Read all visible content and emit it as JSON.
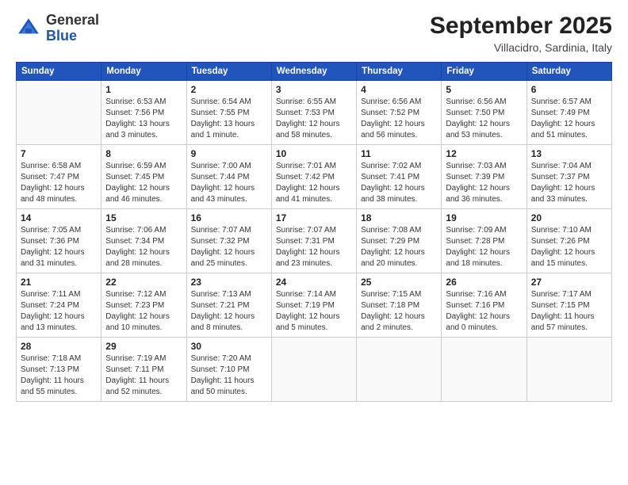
{
  "header": {
    "logo_general": "General",
    "logo_blue": "Blue",
    "month_title": "September 2025",
    "subtitle": "Villacidro, Sardinia, Italy"
  },
  "days_of_week": [
    "Sunday",
    "Monday",
    "Tuesday",
    "Wednesday",
    "Thursday",
    "Friday",
    "Saturday"
  ],
  "weeks": [
    [
      {
        "day": "",
        "info": ""
      },
      {
        "day": "1",
        "info": "Sunrise: 6:53 AM\nSunset: 7:56 PM\nDaylight: 13 hours\nand 3 minutes."
      },
      {
        "day": "2",
        "info": "Sunrise: 6:54 AM\nSunset: 7:55 PM\nDaylight: 13 hours\nand 1 minute."
      },
      {
        "day": "3",
        "info": "Sunrise: 6:55 AM\nSunset: 7:53 PM\nDaylight: 12 hours\nand 58 minutes."
      },
      {
        "day": "4",
        "info": "Sunrise: 6:56 AM\nSunset: 7:52 PM\nDaylight: 12 hours\nand 56 minutes."
      },
      {
        "day": "5",
        "info": "Sunrise: 6:56 AM\nSunset: 7:50 PM\nDaylight: 12 hours\nand 53 minutes."
      },
      {
        "day": "6",
        "info": "Sunrise: 6:57 AM\nSunset: 7:49 PM\nDaylight: 12 hours\nand 51 minutes."
      }
    ],
    [
      {
        "day": "7",
        "info": "Sunrise: 6:58 AM\nSunset: 7:47 PM\nDaylight: 12 hours\nand 48 minutes."
      },
      {
        "day": "8",
        "info": "Sunrise: 6:59 AM\nSunset: 7:45 PM\nDaylight: 12 hours\nand 46 minutes."
      },
      {
        "day": "9",
        "info": "Sunrise: 7:00 AM\nSunset: 7:44 PM\nDaylight: 12 hours\nand 43 minutes."
      },
      {
        "day": "10",
        "info": "Sunrise: 7:01 AM\nSunset: 7:42 PM\nDaylight: 12 hours\nand 41 minutes."
      },
      {
        "day": "11",
        "info": "Sunrise: 7:02 AM\nSunset: 7:41 PM\nDaylight: 12 hours\nand 38 minutes."
      },
      {
        "day": "12",
        "info": "Sunrise: 7:03 AM\nSunset: 7:39 PM\nDaylight: 12 hours\nand 36 minutes."
      },
      {
        "day": "13",
        "info": "Sunrise: 7:04 AM\nSunset: 7:37 PM\nDaylight: 12 hours\nand 33 minutes."
      }
    ],
    [
      {
        "day": "14",
        "info": "Sunrise: 7:05 AM\nSunset: 7:36 PM\nDaylight: 12 hours\nand 31 minutes."
      },
      {
        "day": "15",
        "info": "Sunrise: 7:06 AM\nSunset: 7:34 PM\nDaylight: 12 hours\nand 28 minutes."
      },
      {
        "day": "16",
        "info": "Sunrise: 7:07 AM\nSunset: 7:32 PM\nDaylight: 12 hours\nand 25 minutes."
      },
      {
        "day": "17",
        "info": "Sunrise: 7:07 AM\nSunset: 7:31 PM\nDaylight: 12 hours\nand 23 minutes."
      },
      {
        "day": "18",
        "info": "Sunrise: 7:08 AM\nSunset: 7:29 PM\nDaylight: 12 hours\nand 20 minutes."
      },
      {
        "day": "19",
        "info": "Sunrise: 7:09 AM\nSunset: 7:28 PM\nDaylight: 12 hours\nand 18 minutes."
      },
      {
        "day": "20",
        "info": "Sunrise: 7:10 AM\nSunset: 7:26 PM\nDaylight: 12 hours\nand 15 minutes."
      }
    ],
    [
      {
        "day": "21",
        "info": "Sunrise: 7:11 AM\nSunset: 7:24 PM\nDaylight: 12 hours\nand 13 minutes."
      },
      {
        "day": "22",
        "info": "Sunrise: 7:12 AM\nSunset: 7:23 PM\nDaylight: 12 hours\nand 10 minutes."
      },
      {
        "day": "23",
        "info": "Sunrise: 7:13 AM\nSunset: 7:21 PM\nDaylight: 12 hours\nand 8 minutes."
      },
      {
        "day": "24",
        "info": "Sunrise: 7:14 AM\nSunset: 7:19 PM\nDaylight: 12 hours\nand 5 minutes."
      },
      {
        "day": "25",
        "info": "Sunrise: 7:15 AM\nSunset: 7:18 PM\nDaylight: 12 hours\nand 2 minutes."
      },
      {
        "day": "26",
        "info": "Sunrise: 7:16 AM\nSunset: 7:16 PM\nDaylight: 12 hours\nand 0 minutes."
      },
      {
        "day": "27",
        "info": "Sunrise: 7:17 AM\nSunset: 7:15 PM\nDaylight: 11 hours\nand 57 minutes."
      }
    ],
    [
      {
        "day": "28",
        "info": "Sunrise: 7:18 AM\nSunset: 7:13 PM\nDaylight: 11 hours\nand 55 minutes."
      },
      {
        "day": "29",
        "info": "Sunrise: 7:19 AM\nSunset: 7:11 PM\nDaylight: 11 hours\nand 52 minutes."
      },
      {
        "day": "30",
        "info": "Sunrise: 7:20 AM\nSunset: 7:10 PM\nDaylight: 11 hours\nand 50 minutes."
      },
      {
        "day": "",
        "info": ""
      },
      {
        "day": "",
        "info": ""
      },
      {
        "day": "",
        "info": ""
      },
      {
        "day": "",
        "info": ""
      }
    ]
  ]
}
